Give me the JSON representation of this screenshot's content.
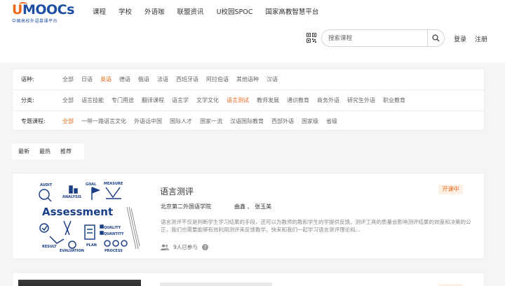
{
  "brand": {
    "logo_text_accent": "U",
    "logo_text_main": "MOOCs",
    "logo_subtitle": "中国高校外语慕课平台",
    "accent_color": "#e96a1c",
    "brand_color": "#1f4fa3"
  },
  "nav": {
    "items": [
      "课程",
      "学校",
      "外语咖",
      "联盟资讯",
      "U校园SPOC",
      "国家高教智慧平台"
    ]
  },
  "header": {
    "search_placeholder": "搜索课程",
    "search_icon": "search-icon",
    "qr_icon": "qr-code-icon",
    "login_label": "登录",
    "register_label": "注册"
  },
  "filters": {
    "language": {
      "label": "语种:",
      "options": [
        "全部",
        "日语",
        "英语",
        "德语",
        "俄语",
        "法语",
        "西班牙语",
        "阿拉伯语",
        "其他语种",
        "汉语"
      ],
      "active": "英语"
    },
    "category": {
      "label": "分类:",
      "options": [
        "全部",
        "语言技能",
        "专门用途",
        "翻译课程",
        "语言学",
        "文学文化",
        "语言测试",
        "教师发展",
        "通识教育",
        "商务外语",
        "研究生外语",
        "职业教育"
      ],
      "active": "语言测试"
    },
    "topic": {
      "label": "专题课程:",
      "options": [
        "全部",
        "一带一路语言文化",
        "外语话中国",
        "国际人才",
        "国家一流",
        "汉语国际教育",
        "西部外语",
        "国家级",
        "省级"
      ],
      "active": "全部"
    }
  },
  "sort": {
    "tabs": [
      "最新",
      "最热",
      "推荐"
    ]
  },
  "course": {
    "title": "语言测评",
    "status": "开课中",
    "school": "北京第二外国语学院",
    "teachers": "曲鑫 、 张玉美",
    "description": "语言测评不仅是判断学生学习结果的手段，还可以为教师的教和学生的学提供反馈。测评工具的质量会影响测评结果的效度和决策的公正，我们也需要能够有效利用测评来反馈教学。快来和我们一起学习语言测评理论和...",
    "participants": "9人已参与",
    "thumbnail_words": [
      "AUDIT",
      "ANALYSIS",
      "GOAL",
      "MEASURE",
      "Assessment",
      "QUALITY",
      "QUANTITY",
      "RESULT",
      "EVALUATION",
      "PLAN",
      "PROCESS"
    ]
  }
}
